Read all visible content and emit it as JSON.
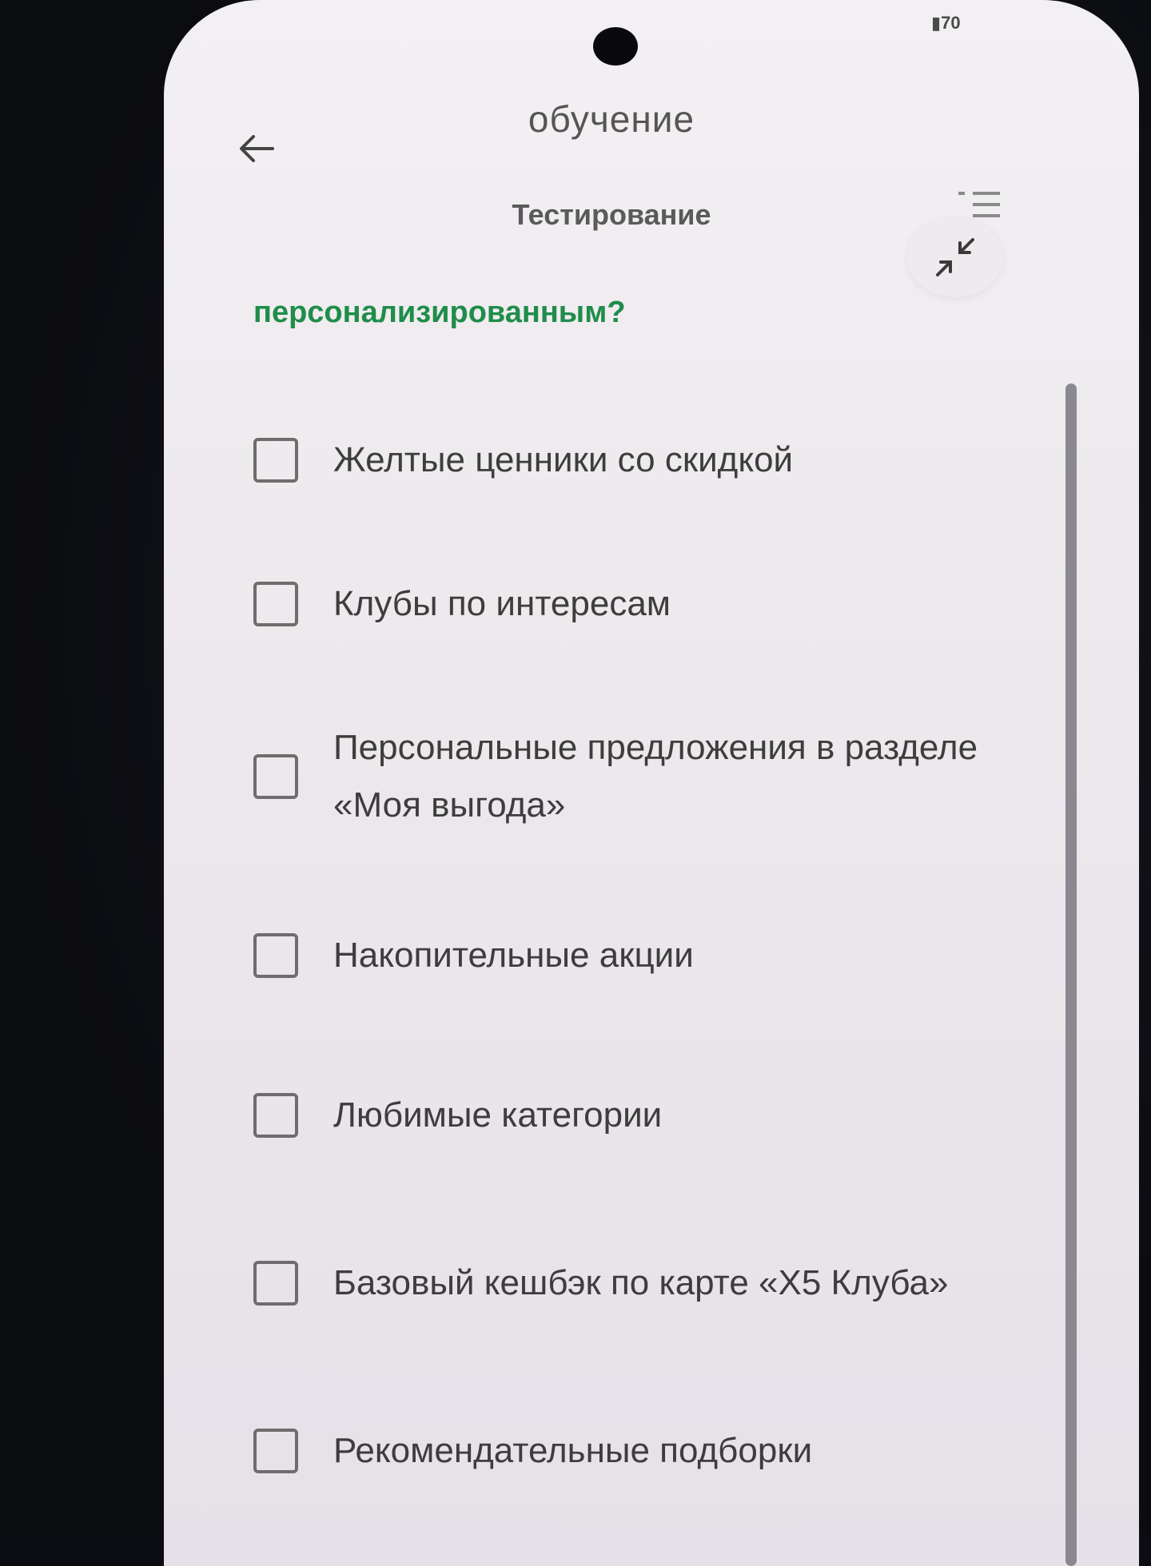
{
  "status_bar": {
    "battery": "70"
  },
  "header": {
    "title": "обучение",
    "subtitle": "Тестирование"
  },
  "question": {
    "text": "персонализированным?"
  },
  "options": [
    {
      "label": "Желтые ценники со скидкой",
      "checked": false
    },
    {
      "label": "Клубы по интересам",
      "checked": false
    },
    {
      "label": "Персональные предложения в разделе «Моя выгода»",
      "checked": false
    },
    {
      "label": "Накопительные акции",
      "checked": false
    },
    {
      "label": "Любимые категории",
      "checked": false
    },
    {
      "label": "Базовый кешбэк по карте «X5 Клуба»",
      "checked": false
    },
    {
      "label": "Рекомендательные подборки",
      "checked": false
    }
  ],
  "icons": {
    "back": "arrow-left-icon",
    "list": "list-icon",
    "collapse": "collapse-arrows-icon"
  },
  "colors": {
    "accent_green": "#1f8d4a",
    "background": "#eeeaee"
  }
}
